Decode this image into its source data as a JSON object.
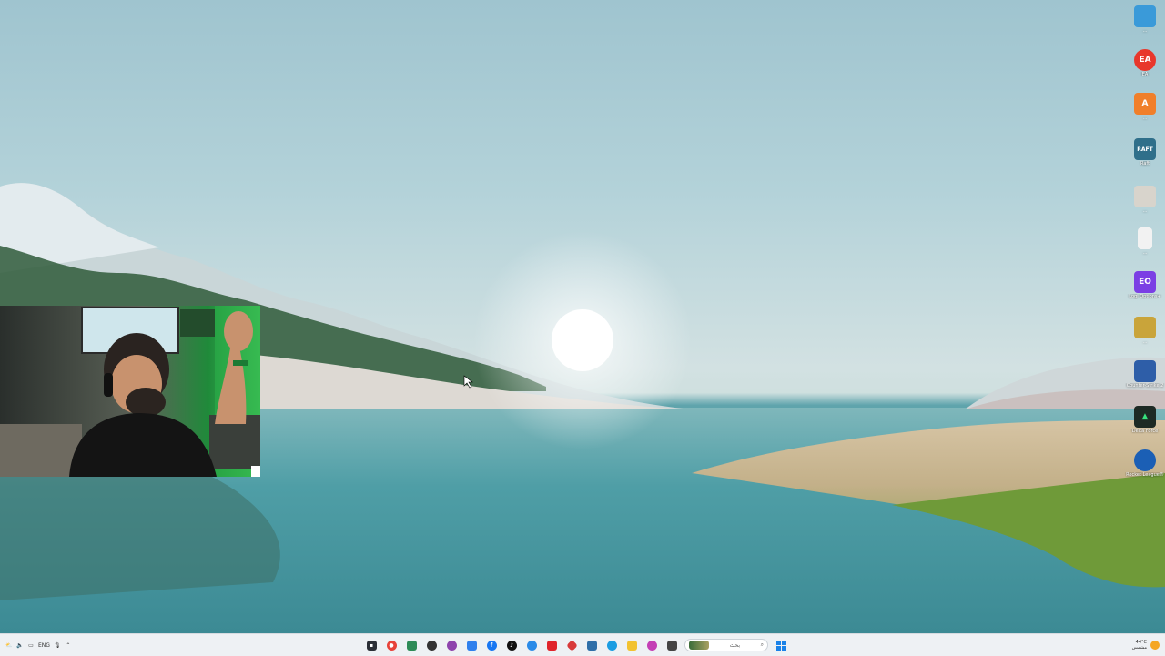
{
  "desktop": {
    "icons": [
      {
        "name": "desktop-icon-1",
        "label": "...",
        "color": "#3a9ad9",
        "glyph": ""
      },
      {
        "name": "desktop-icon-ea",
        "label": "EA",
        "color": "#e8372b",
        "glyph": "EA"
      },
      {
        "name": "desktop-icon-3",
        "label": "...",
        "color": "#f07f2a",
        "glyph": "A"
      },
      {
        "name": "desktop-icon-raft",
        "label": "Raft",
        "color": "#2f6f8a",
        "glyph": "RAFT"
      },
      {
        "name": "desktop-icon-5",
        "label": "...",
        "color": "#d8d4cc",
        "glyph": ""
      },
      {
        "name": "desktop-icon-6",
        "label": "...",
        "color": "#f2f2f2",
        "glyph": ""
      },
      {
        "name": "desktop-icon-logi",
        "label": "Logi Options+",
        "color": "#7b3fe4",
        "glyph": "EO"
      },
      {
        "name": "desktop-icon-8",
        "label": "...",
        "color": "#c9a43a",
        "glyph": ""
      },
      {
        "name": "desktop-icon-counter-strike",
        "label": "Counter-Strike 2",
        "color": "#2e5ea8",
        "glyph": ""
      },
      {
        "name": "desktop-icon-delta-force",
        "label": "Delta Force",
        "color": "#1d2a24",
        "glyph": "▲"
      },
      {
        "name": "desktop-icon-rocket-league",
        "label": "Rocket League®",
        "color": "#1b5fb5",
        "glyph": ""
      }
    ]
  },
  "taskbar": {
    "lang": "ENG",
    "search_placeholder": "بحث",
    "apps": [
      {
        "name": "taskbar-app-terminal",
        "color": "#2b2f36",
        "glyph": ""
      },
      {
        "name": "taskbar-app-chrome",
        "color": "#e7433a",
        "glyph": ""
      },
      {
        "name": "taskbar-app-2",
        "color": "#2e8b57",
        "glyph": ""
      },
      {
        "name": "taskbar-app-3",
        "color": "#333333",
        "glyph": ""
      },
      {
        "name": "taskbar-app-4",
        "color": "#8e44ad",
        "glyph": ""
      },
      {
        "name": "taskbar-app-5",
        "color": "#2f80ed",
        "glyph": ""
      },
      {
        "name": "taskbar-app-facebook",
        "color": "#1877f2",
        "glyph": "f"
      },
      {
        "name": "taskbar-app-tiktok",
        "color": "#111111",
        "glyph": ""
      },
      {
        "name": "taskbar-app-8",
        "color": "#2a8be8",
        "glyph": ""
      },
      {
        "name": "taskbar-app-9",
        "color": "#e0242b",
        "glyph": ""
      },
      {
        "name": "taskbar-app-10",
        "color": "#d83a3a",
        "glyph": ""
      },
      {
        "name": "taskbar-app-11",
        "color": "#2f6fa8",
        "glyph": ""
      },
      {
        "name": "taskbar-app-edge",
        "color": "#1b9de2",
        "glyph": ""
      },
      {
        "name": "taskbar-app-explorer",
        "color": "#f2c230",
        "glyph": ""
      },
      {
        "name": "taskbar-app-14",
        "color": "#c43fb5",
        "glyph": ""
      },
      {
        "name": "taskbar-app-15",
        "color": "#444444",
        "glyph": ""
      }
    ],
    "weather_temp": "44°C",
    "weather_desc": "مشمس"
  }
}
